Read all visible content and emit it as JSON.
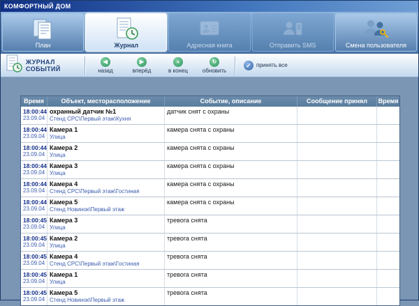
{
  "window": {
    "title": "КОМФОРТНЫЙ ДОМ"
  },
  "nav": {
    "items": [
      {
        "label": "План",
        "state": "normal"
      },
      {
        "label": "Журнал",
        "state": "active"
      },
      {
        "label": "Адресная книга",
        "state": "disabled"
      },
      {
        "label": "Отправить SMS",
        "state": "disabled"
      },
      {
        "label": "Смена пользователя",
        "state": "normal"
      }
    ]
  },
  "toolbar": {
    "title": "ЖУРНАЛ СОБЫТИЙ",
    "buttons": [
      {
        "label": "назад",
        "glyph": "◀"
      },
      {
        "label": "вперёд",
        "glyph": "▶"
      },
      {
        "label": "в конец",
        "glyph": "»"
      },
      {
        "label": "обновить",
        "glyph": "↻"
      },
      {
        "label": "принять все",
        "glyph": "✓"
      }
    ]
  },
  "table": {
    "headers": [
      "Время",
      "Объект, месторасположение",
      "Событие, описание",
      "Сообщение принял",
      "Время"
    ],
    "rows": [
      {
        "time": "18:00:44",
        "date": "23.09.04",
        "object": "охранный датчик №1",
        "location": "Стенд СРС\\Первый этаж\\Кухня",
        "event": "датчик снят с охраны",
        "received": "",
        "time2": ""
      },
      {
        "time": "18:00:44",
        "date": "23.09.04",
        "object": "Камера 1",
        "location": "Улица",
        "event": "камера снята с охраны",
        "received": "",
        "time2": ""
      },
      {
        "time": "18:00:44",
        "date": "23.09.04",
        "object": "Камера 2",
        "location": "Улица",
        "event": "камера снята с охраны",
        "received": "",
        "time2": ""
      },
      {
        "time": "18:00:44",
        "date": "23.09.04",
        "object": "Камера 3",
        "location": "Улица",
        "event": "камера снята с охраны",
        "received": "",
        "time2": ""
      },
      {
        "time": "18:00:44",
        "date": "23.09.04",
        "object": "Камера 4",
        "location": "Стенд СРС\\Первый этаж\\Гостиная",
        "event": "камера снята с охраны",
        "received": "",
        "time2": ""
      },
      {
        "time": "18:00:44",
        "date": "23.09.04",
        "object": "Камера 5",
        "location": "Стенд Новинок\\Первый этаж",
        "event": "камера снята с охраны",
        "received": "",
        "time2": ""
      },
      {
        "time": "18:00:45",
        "date": "23.09.04",
        "object": "Камера 3",
        "location": "Улица",
        "event": "тревога снята",
        "received": "",
        "time2": ""
      },
      {
        "time": "18:00:45",
        "date": "23.09.04",
        "object": "Камера 2",
        "location": "Улица",
        "event": "тревога снята",
        "received": "",
        "time2": ""
      },
      {
        "time": "18:00:45",
        "date": "23.09.04",
        "object": "Камера 4",
        "location": "Стенд СРС\\Первый этаж\\Гостиная",
        "event": "тревога снята",
        "received": "",
        "time2": ""
      },
      {
        "time": "18:00:45",
        "date": "23.09.04",
        "object": "Камера 1",
        "location": "Улица",
        "event": "тревога снята",
        "received": "",
        "time2": ""
      },
      {
        "time": "18:00:45",
        "date": "23.09.04",
        "object": "Камера 5",
        "location": "Стенд Новинок\\Первый этаж",
        "event": "тревога снята",
        "received": "",
        "time2": ""
      }
    ]
  },
  "colors": {
    "toolbar_blue": "#4a78ad",
    "header_bg": "#5f7f9f",
    "time_text": "#16308a",
    "link_text": "#3a5cae"
  }
}
